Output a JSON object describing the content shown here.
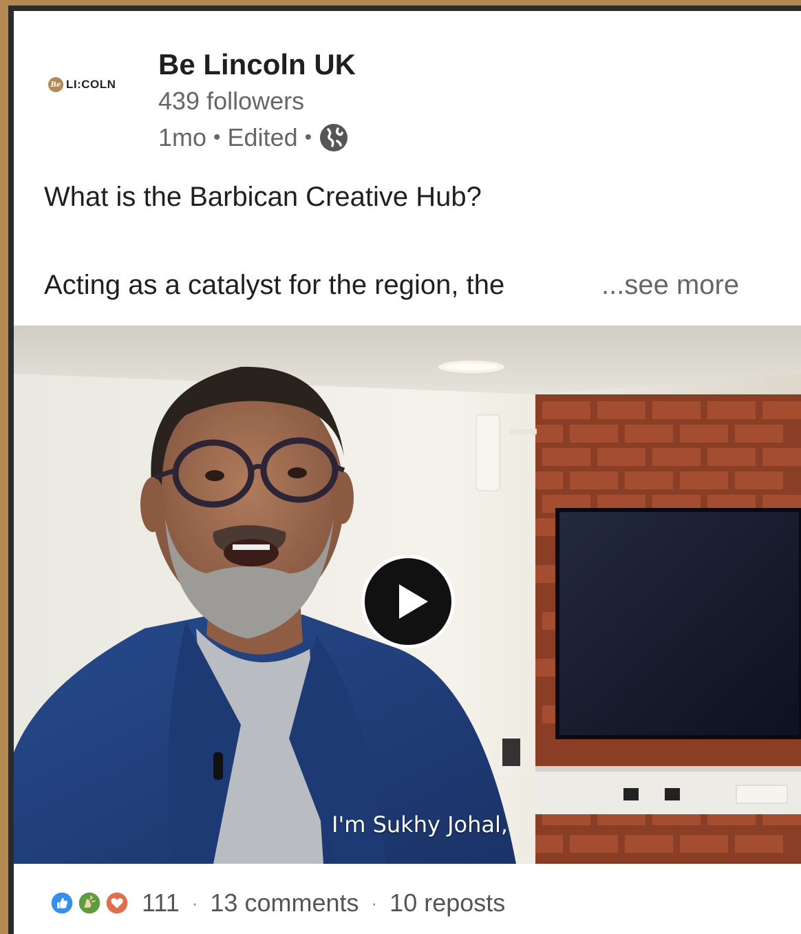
{
  "post": {
    "logo_text": "LI:COLN",
    "company_name": "Be Lincoln UK",
    "followers": "439 followers",
    "age": "1mo",
    "edited": "Edited",
    "title": "What is the Barbican Creative Hub?",
    "body": "Acting as a catalyst for the region, the",
    "see_more": "...see more"
  },
  "video": {
    "caption": "I'm Sukhy Johal,"
  },
  "social": {
    "reaction_count": "111",
    "comments": "13 comments",
    "reposts": "10 reposts"
  },
  "colors": {
    "frame": "#b58a52",
    "like": "#378fe9",
    "celebrate": "#5f9b41",
    "love": "#df704d"
  }
}
